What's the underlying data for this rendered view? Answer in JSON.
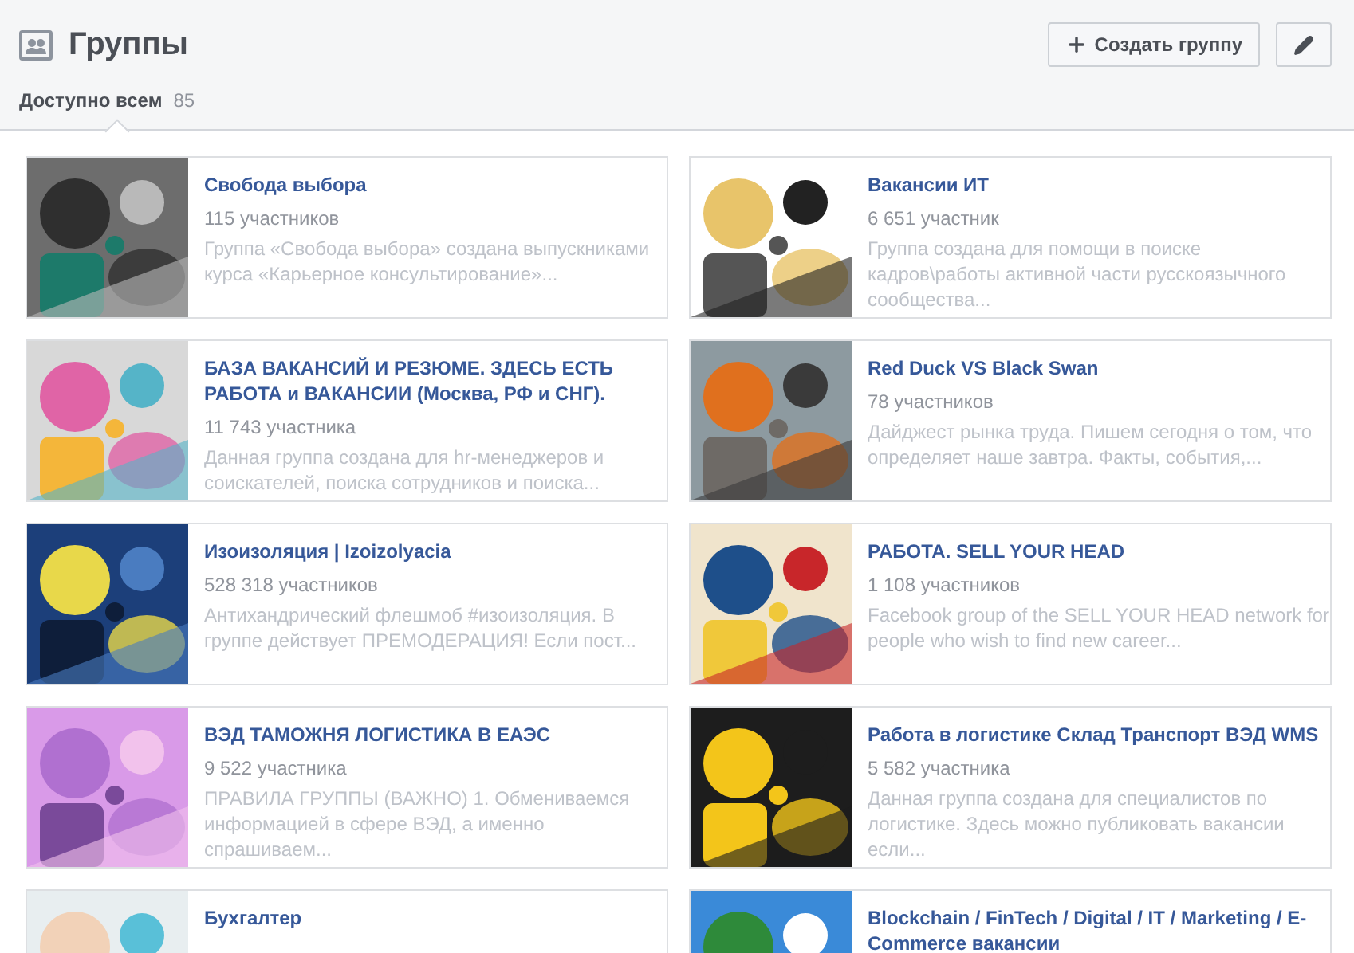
{
  "header": {
    "title": "Группы",
    "create_button": "Создать группу"
  },
  "tabs": [
    {
      "label": "Доступно всем",
      "count": "85",
      "selected": true
    }
  ],
  "groups": [
    {
      "name": "Свобода выбора",
      "members": "115 участников",
      "description": "Группа «Свобода выбора» создана выпускниками курса «Карьерное консультирование»..."
    },
    {
      "name": "Вакансии ИТ",
      "members": "6 651 участник",
      "description": "Группа создана для помощи в поиске кадров\\работы активной части русскоязычного сообщества..."
    },
    {
      "name": "БАЗА ВАКАНСИЙ И РЕЗЮМЕ. ЗДЕСЬ ЕСТЬ РАБОТА и ВАКАНСИИ (Москва, РФ и СНГ).",
      "members": "11 743 участника",
      "description": "Данная группа создана для hr-менеджеров и соискателей, поиска сотрудников и поиска..."
    },
    {
      "name": "Red Duck VS Black Swan",
      "members": "78 участников",
      "description": "Дайджест рынка труда. Пишем сегодня о том, что определяет наше завтра. Факты, события,..."
    },
    {
      "name": "Изоизоляция | Izoizolyacia",
      "members": "528 318 участников",
      "description": "Антихандрический флешмоб #изоизоляция. В группе действует ПРЕМОДЕРАЦИЯ! Если пост..."
    },
    {
      "name": "РАБОТА. SELL YOUR HEAD",
      "members": "1 108 участников",
      "description": "Facebook group of the SELL YOUR HEAD network for people who wish to find new career..."
    },
    {
      "name": "ВЭД ТАМОЖНЯ ЛОГИСТИКА В ЕАЭС",
      "members": "9 522 участника",
      "description": "ПРАВИЛА ГРУППЫ (ВАЖНО) 1. Обмениваемся информацией в сфере ВЭД, а именно спрашиваем..."
    },
    {
      "name": "Работа в логистике Склад Транспорт ВЭД WMS",
      "members": "5 582 участника",
      "description": "Данная группа создана для специалистов по логистике. Здесь можно публиковать вакансии если..."
    },
    {
      "name": "Бухгалтер"
    },
    {
      "name": "Blockchain / FinTech / Digital / IT / Marketing / E-Commerce вакансии"
    }
  ]
}
